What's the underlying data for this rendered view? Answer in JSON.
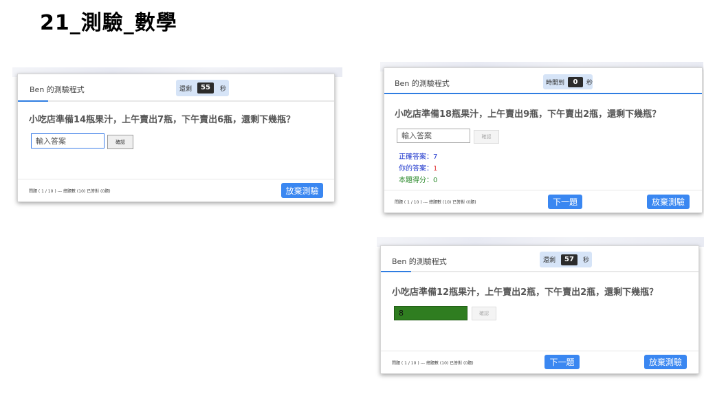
{
  "slide": {
    "title": "21_測驗_數學"
  },
  "panels": [
    {
      "brand": "Ben 的測驗程式",
      "timer_prefix": "還剩",
      "timer_value": "55",
      "timer_suffix": "秒",
      "question": "小吃店準備14瓶果汁，上午賣出7瓶，下午賣出6瓶，還剩下幾瓶？",
      "input_placeholder": "輸入答案",
      "input_value": "",
      "confirm_label": "確認",
      "status": "問題 ( 1 / 10 ) --- 總題數 (10) 已答對 (0題)",
      "quit_label": "放棄測驗"
    },
    {
      "brand": "Ben 的測驗程式",
      "timer_prefix": "時間到",
      "timer_value": "0",
      "timer_suffix": "秒",
      "question": "小吃店準備18瓶果汁，上午賣出9瓶，下午賣出2瓶，還剩下幾瓶？",
      "input_placeholder": "輸入答案",
      "input_value": "",
      "confirm_label": "確認",
      "correct_label": "正確答案：",
      "correct_value": "7",
      "your_label": "你的答案：",
      "your_value": "1",
      "score_label": "本題得分：",
      "score_value": "0",
      "status": "問題 ( 1 / 10 ) --- 總題數 (10) 已答對 (0題)",
      "next_label": "下一題",
      "quit_label": "放棄測驗"
    },
    {
      "brand": "Ben 的測驗程式",
      "timer_prefix": "還剩",
      "timer_value": "57",
      "timer_suffix": "秒",
      "question": "小吃店準備12瓶果汁，上午賣出2瓶，下午賣出2瓶，還剩下幾瓶？",
      "input_placeholder": "",
      "input_value": "8",
      "confirm_label": "確認",
      "status": "問題 ( 1 / 10 ) --- 總題數 (10) 已答對 (0題)",
      "next_label": "下一題",
      "quit_label": "放棄測驗"
    }
  ],
  "colors": {
    "accent": "#3a87f1",
    "correct_answer": "#1a33cc",
    "your_answer_value": "#e03030",
    "score": "#2e8b2e",
    "answer_fill_green": "#2f7d20",
    "timer_bg": "#d6e4f7"
  }
}
